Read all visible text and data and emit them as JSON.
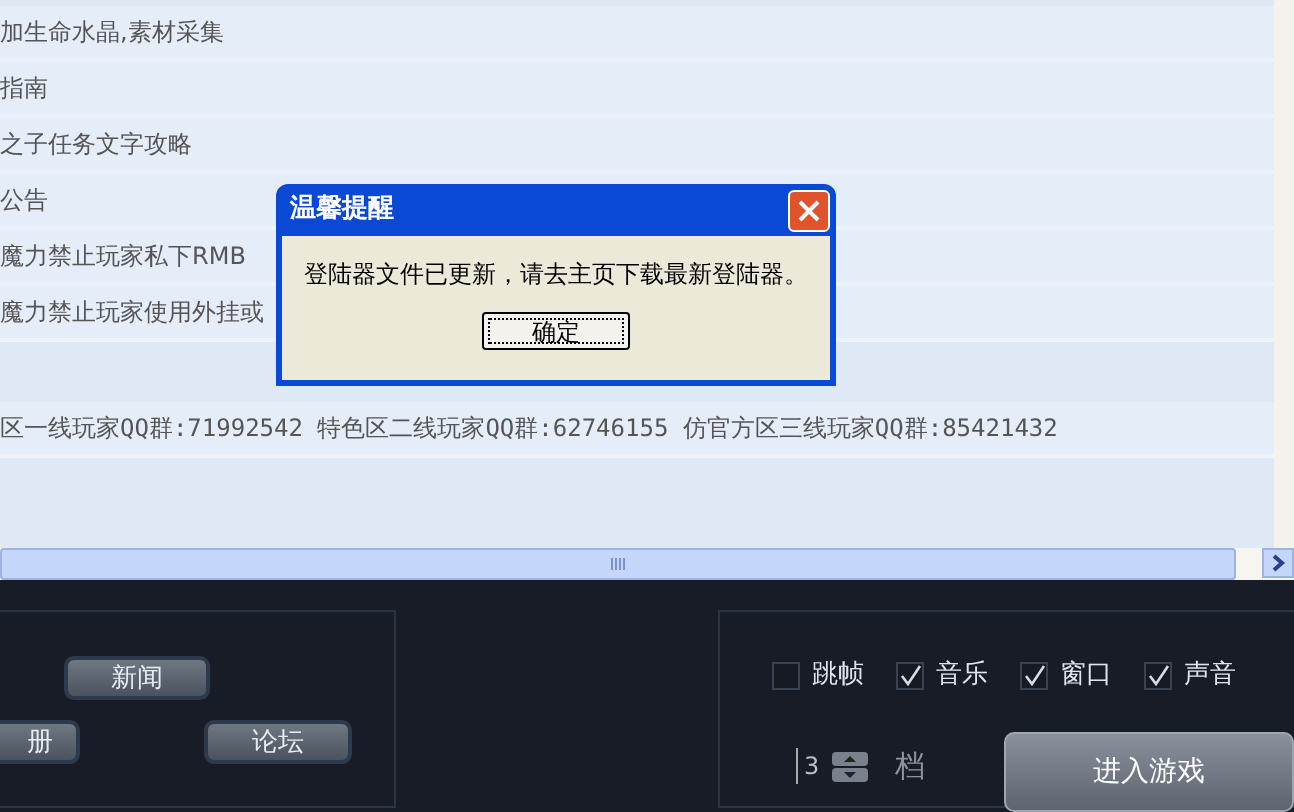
{
  "news_list": {
    "rows": [
      {
        "text": "加生命水晶,素材采集"
      },
      {
        "text": "指南"
      },
      {
        "text": "之子任务文字攻略"
      },
      {
        "text": "公告"
      },
      {
        "text": "魔力禁止玩家私下RMB"
      },
      {
        "text": "魔力禁止玩家使用外挂或"
      },
      {
        "text": "区一线玩家QQ群:71992542 特色区二线玩家QQ群:62746155 仿官方区三线玩家QQ群:85421432"
      }
    ]
  },
  "dialog": {
    "title": "温馨提醒",
    "message": "登陆器文件已更新，请去主页下载最新登陆器。",
    "button": "确定"
  },
  "links": [
    {
      "label": "新闻"
    },
    {
      "label": "册"
    },
    {
      "label": "论坛"
    }
  ],
  "options": [
    {
      "label": "跳帧",
      "checked": false
    },
    {
      "label": "音乐",
      "checked": true
    },
    {
      "label": "窗口",
      "checked": true
    },
    {
      "label": "声音",
      "checked": true
    }
  ],
  "speed": {
    "value": "3",
    "unit": "档"
  },
  "start_button": "进入游戏"
}
